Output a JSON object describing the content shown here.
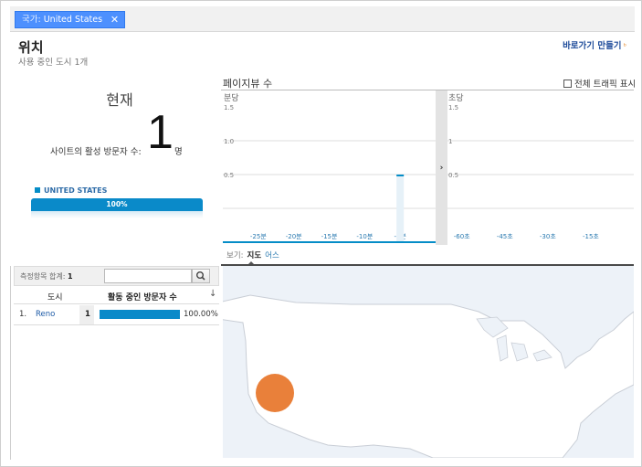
{
  "filter": {
    "label": "국가:",
    "value": "United States",
    "close_icon": "close-icon"
  },
  "header": {
    "title": "위치",
    "subtitle": "사용 중인 도시 1개",
    "shortcut_label": "바로가기 만들기",
    "shortcut_icon": "beta-mark-icon"
  },
  "right_now": {
    "label": "현재",
    "active_label": "사이트의 활성 방문자 수:",
    "count": "1",
    "unit": "명",
    "country_name": "UNITED STATES",
    "country_percent": "100%",
    "country_share": 1.0
  },
  "pageviews": {
    "title": "페이지뷰 수",
    "toggle_label": "전체 트래픽 표시"
  },
  "chart_data": [
    {
      "type": "bar",
      "title": "분당",
      "x_ticks": [
        "-25분",
        "-20분",
        "-15분",
        "-10분",
        "-5분"
      ],
      "y_ticks": [
        "1.5",
        "1.0",
        "0.5"
      ],
      "ylim": [
        0,
        2
      ],
      "x": [
        -5
      ],
      "values": [
        1.0
      ],
      "grid": true
    },
    {
      "type": "bar",
      "title": "초당",
      "x_ticks": [
        "-60초",
        "-45초",
        "-30초",
        "-15초"
      ],
      "y_ticks": [
        "1.5",
        "1",
        "0.5"
      ],
      "ylim": [
        0,
        2
      ],
      "x": [],
      "values": [],
      "grid": true
    }
  ],
  "view_tabs": {
    "prefix": "보기:",
    "selected": "지도",
    "other": "어스"
  },
  "table": {
    "rows_label": "측정항목 합계:",
    "rows_count": "1",
    "search_placeholder": "",
    "search_icon": "magnifier-icon",
    "columns": {
      "city": "도시",
      "active": "활동 중인 방문자 수",
      "sort_icon": "sort-down-icon"
    },
    "rows": [
      {
        "index": "1.",
        "city": "Reno",
        "count": "1",
        "share": 1.0,
        "percent": "100.00%"
      }
    ]
  },
  "map": {
    "marker_color": "#e8792f",
    "land_color": "#ffffff",
    "water_color": "#edf2f8"
  },
  "colors": {
    "accent": "#058dc7",
    "chip": "#4d90fe",
    "link": "#1c4a99"
  }
}
